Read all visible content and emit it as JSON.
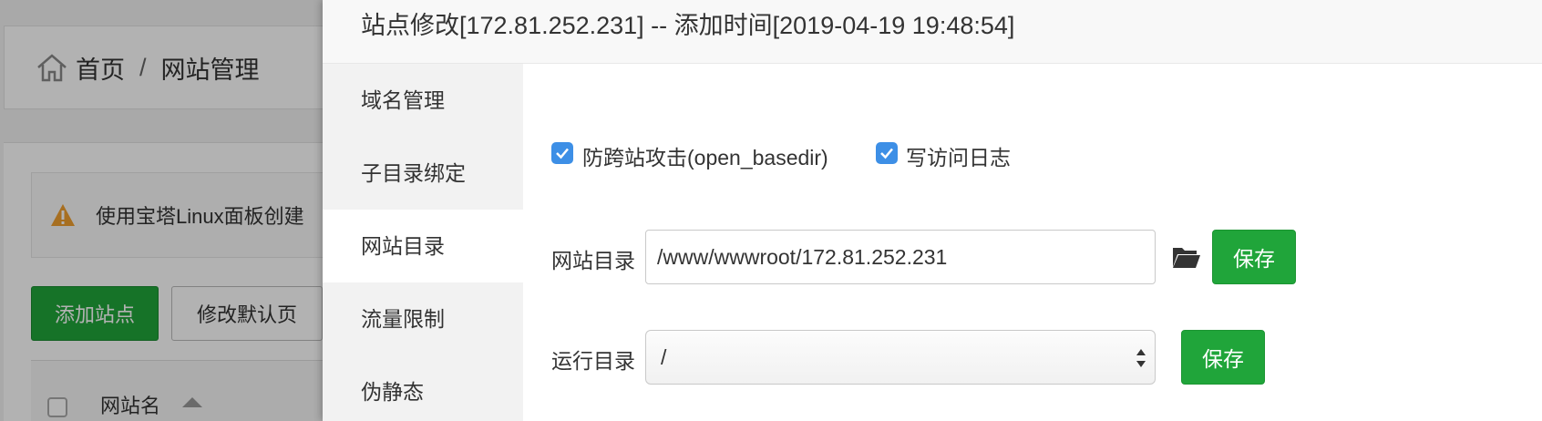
{
  "background": {
    "breadcrumb": {
      "home": "首页",
      "separator": "/",
      "current": "网站管理"
    },
    "alert_text": "使用宝塔Linux面板创建",
    "buttons": {
      "add_site": "添加站点",
      "edit_default_page": "修改默认页"
    },
    "table": {
      "col_site_name": "网站名"
    }
  },
  "modal": {
    "title": "站点修改[172.81.252.231] -- 添加时间[2019-04-19 19:48:54]",
    "sidebar": {
      "items": [
        {
          "label": "域名管理",
          "active": false
        },
        {
          "label": "子目录绑定",
          "active": false
        },
        {
          "label": "网站目录",
          "active": true
        },
        {
          "label": "流量限制",
          "active": false
        },
        {
          "label": "伪静态",
          "active": false
        }
      ]
    },
    "options": {
      "open_basedir": {
        "label": "防跨站攻击(open_basedir)",
        "checked": true
      },
      "access_log": {
        "label": "写访问日志",
        "checked": true
      }
    },
    "site_dir": {
      "label": "网站目录",
      "value": "/www/wwwroot/172.81.252.231",
      "save": "保存"
    },
    "run_dir": {
      "label": "运行目录",
      "value": "/",
      "save": "保存"
    }
  },
  "colors": {
    "accent_green": "#20a53a",
    "checkbox_blue": "#3d8fe6"
  },
  "icons": [
    "home-icon",
    "warning-icon",
    "checkbox-checked-icon",
    "folder-open-icon",
    "select-arrows-icon",
    "sort-up-icon"
  ]
}
